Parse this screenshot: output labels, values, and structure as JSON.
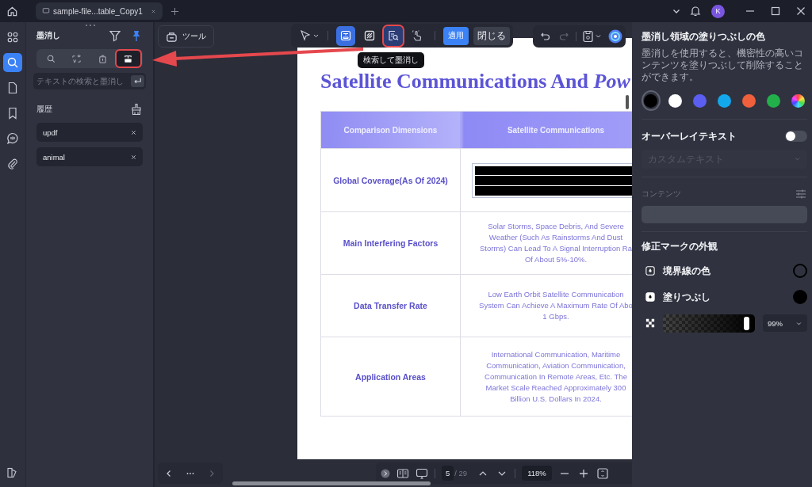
{
  "tabs": [
    {
      "label": "sample-file...table_Copy1",
      "selected": true
    }
  ],
  "avatar": "K",
  "rail": [
    {
      "kind": "apps",
      "selected": false
    },
    {
      "kind": "search",
      "selected": true
    },
    {
      "kind": "pages",
      "selected": false
    },
    {
      "kind": "bookmark",
      "selected": false
    },
    {
      "kind": "comment",
      "selected": false
    },
    {
      "kind": "attachment",
      "selected": false
    },
    {
      "kind": "layers",
      "selected": false
    }
  ],
  "panel": {
    "title": "墨消し",
    "modes": [
      {
        "kind": "search",
        "selected": false,
        "highlighted": false
      },
      {
        "kind": "replace",
        "selected": false,
        "highlighted": false
      },
      {
        "kind": "delete",
        "selected": false,
        "highlighted": false
      },
      {
        "kind": "redact",
        "selected": true,
        "highlighted": true
      }
    ],
    "search": {
      "placeholder": "テキストの検索と墨消し"
    },
    "history_title": "履歴",
    "history": [
      {
        "text": "updf"
      },
      {
        "text": "animal"
      }
    ]
  },
  "toolbar": {
    "tools_label": "ツール",
    "tools": [
      {
        "kind": "select",
        "selected": false,
        "highlighted": false
      },
      {
        "kind": "area",
        "selected": true,
        "highlighted": false
      },
      {
        "kind": "pattern",
        "selected": false,
        "highlighted": false
      },
      {
        "kind": "search-redact",
        "selected": true,
        "highlighted": true
      },
      {
        "kind": "hand",
        "selected": false,
        "highlighted": false
      }
    ],
    "apply": "適用",
    "close": "閉じる",
    "tooltip": "検索して墨消し",
    "actions": [
      {
        "kind": "undo",
        "disabled": false
      },
      {
        "kind": "redo",
        "disabled": true
      }
    ]
  },
  "document": {
    "title": "Satellite Communications And *Pow*",
    "columns": [
      "Comparison Dimensions",
      "Satellite Communications"
    ],
    "rows": [
      {
        "label": "Global Coverage(As Of 2024)",
        "redacted": true
      },
      {
        "label": "Main Interfering Factors",
        "redacted": false,
        "lines": [
          "Solar Storms, Space Debris, And Severe",
          "Weather (Such As Rainstorms And Dust",
          "Storms) Can Lead To A Signal Interruption Ra",
          "Of About 5%-10%."
        ]
      },
      {
        "label": "Data Transfer Rate",
        "redacted": false,
        "lines": [
          "Low Earth Orbit Satellite Communication",
          "System Can Achieve A Maximum Rate Of Abo",
          "1 Gbps."
        ]
      },
      {
        "label": "Application Areas",
        "redacted": false,
        "lines": [
          "International Communication, Maritime",
          "Communication, Aviation Communication,",
          "Communication In Remote Areas, Etc. The",
          "Market Scale Reached Approximately 300",
          "Billion U.S. Dollars In 2024."
        ]
      }
    ]
  },
  "navigation": {
    "back_disabled": false,
    "forward_disabled": true
  },
  "pager": {
    "page": "5",
    "total": "/ 29",
    "zoom": "118%"
  },
  "right_panel": {
    "fill_title": "墨消し領域の塗りつぶしの色",
    "description": "墨消しを使用すると、機密性の高いコンテンツを塗りつぶして削除することができます。",
    "swatches": [
      {
        "kind": "solid",
        "color": "#000000",
        "selected": true
      },
      {
        "kind": "solid",
        "color": "#ffffff",
        "selected": false
      },
      {
        "kind": "solid",
        "color": "#5b5ef0",
        "selected": false
      },
      {
        "kind": "solid",
        "color": "#13a8ec",
        "selected": false
      },
      {
        "kind": "solid",
        "color": "#f0603c",
        "selected": false
      },
      {
        "kind": "solid",
        "color": "#22b04a",
        "selected": false
      },
      {
        "kind": "spectrum",
        "selected": false
      }
    ],
    "overlay": {
      "label": "オーバーレイテキスト",
      "on": false,
      "placeholder": "カスタムテキスト",
      "disabled": true
    },
    "contents": {
      "label": "コンテンツ",
      "disabled": true
    },
    "appearance": {
      "title": "修正マークの外観",
      "items": [
        {
          "kind": "border",
          "label": "境界線の色"
        },
        {
          "kind": "fill",
          "label": "塗りつぶし"
        }
      ]
    },
    "opacity": {
      "level": 0.94,
      "value": "99%"
    }
  }
}
